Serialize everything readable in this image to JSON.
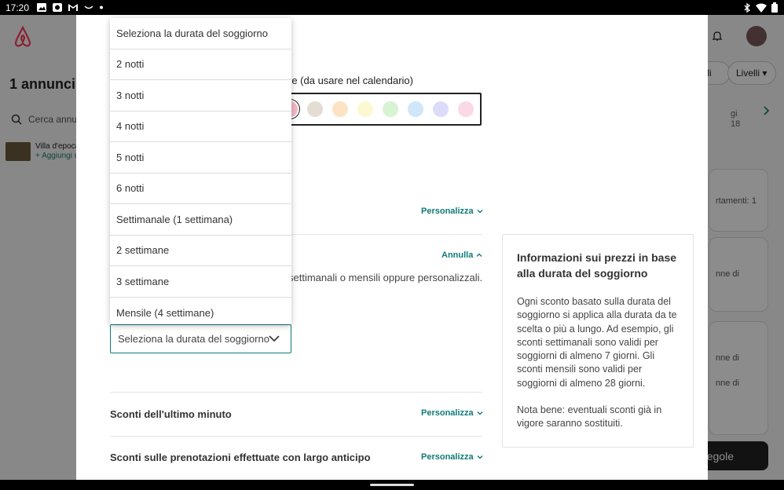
{
  "status_bar": {
    "time": "17:20",
    "icons": [
      "image-icon",
      "app-icon",
      "gmail-icon",
      "smile-icon",
      "dot-icon"
    ],
    "right_icons": [
      "bluetooth-icon",
      "wifi-icon",
      "battery-icon"
    ]
  },
  "background": {
    "title": "1 annunci",
    "search_placeholder": "Cerca annu",
    "listing_name": "Villa d'epoca",
    "listing_action": "+ Aggiungi u",
    "buttons": [
      "bili",
      "Livelli"
    ],
    "calendar_header": [
      "gi",
      "18"
    ],
    "card_texts": [
      "rtamenti: 1",
      "nne di",
      "nne di",
      "nne di"
    ],
    "black_button": "egole"
  },
  "modal": {
    "color_label": "re (da usare nel calendario)",
    "colors": [
      "#f5b8c4",
      "#e4ddd3",
      "#fbe3c3",
      "#fcf8cf",
      "#d7f3d3",
      "#cfe6fb",
      "#dcdcfa",
      "#fad8e6"
    ],
    "personalize_label": "Personalizza",
    "cancel_label": "Annulla",
    "description_tail": "settimanali o mensili oppure personalizzali.",
    "select_value": "Seleziona la durata del soggiorno",
    "last_minute_title": "Sconti dell'ultimo minuto",
    "early_booking_title": "Sconti sulle prenotazioni effettuate con largo anticipo",
    "info": {
      "title": "Informazioni sui prezzi in base alla durata del soggiorno",
      "body": "Ogni sconto basato sulla durata del soggiorno si applica alla durata da te scelta o più a lungo. Ad esempio, gli sconti settimanali sono validi per soggiorni di almeno 7 giorni. Gli sconti mensili sono validi per soggiorni di almeno 28 giorni.",
      "note": "Nota bene: eventuali sconti già in vigore saranno sostituiti."
    }
  },
  "dropdown": {
    "options": [
      "Seleziona la durata del soggiorno",
      "2 notti",
      "3 notti",
      "4 notti",
      "5 notti",
      "6 notti",
      "Settimanale (1 settimana)",
      "2 settimane",
      "3 settimane",
      "Mensile (4 settimane)"
    ]
  },
  "colors": {
    "accent": "#0f7b78",
    "text": "#333333"
  }
}
